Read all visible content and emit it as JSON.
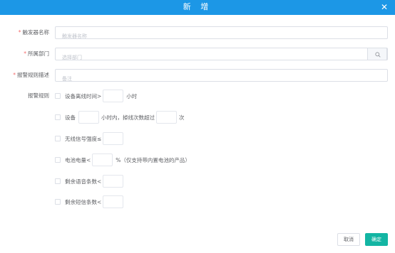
{
  "dialog": {
    "title": "新 增",
    "close_icon": "close-icon"
  },
  "form": {
    "name": {
      "label": "触发器名称",
      "placeholder": "触发器名称",
      "value": ""
    },
    "dept": {
      "label": "所属部门",
      "placeholder": "选择部门",
      "value": "",
      "icon": "search-icon"
    },
    "desc": {
      "label": "报警规则描述",
      "placeholder": "备注",
      "value": ""
    },
    "rules_label": "报警规则",
    "rules": [
      {
        "prefix": "设备离线时间>",
        "suffix": "小时",
        "checked": false
      },
      {
        "prefix": "设备",
        "middle": "小时内，掉线次数超过",
        "suffix": "次",
        "checked": false
      },
      {
        "prefix": "无线信号强度≤",
        "checked": false
      },
      {
        "prefix": "电池电量<",
        "suffix": "%（仅支持带内置电池的产品）",
        "checked": false
      },
      {
        "prefix": "剩余语音条数<",
        "checked": false
      },
      {
        "prefix": "剩余短信条数<",
        "checked": false
      }
    ]
  },
  "footer": {
    "cancel": "取消",
    "ok": "确定"
  },
  "colors": {
    "header": "#1c97e6",
    "primary": "#13b5a3",
    "required": "#f56c6c"
  }
}
